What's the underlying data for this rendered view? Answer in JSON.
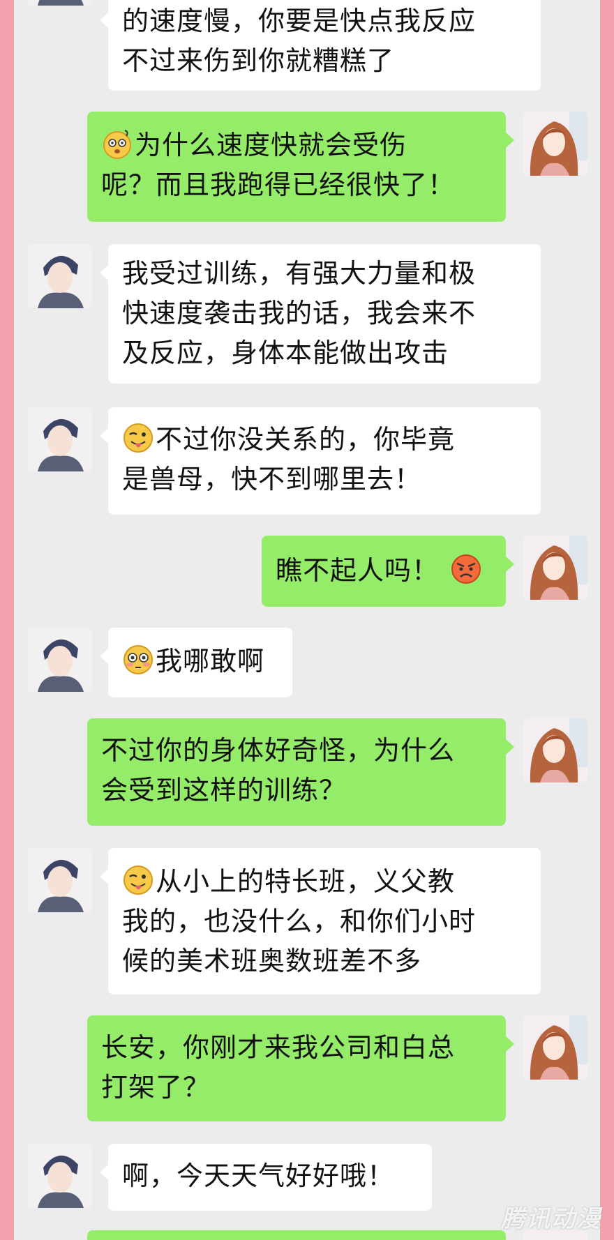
{
  "messages": [
    {
      "from": "boy",
      "lines": [
        "的速度慢，你要是快点我反应",
        "不过来伤到你就糟糕了"
      ]
    },
    {
      "from": "girl",
      "lines": [
        "为什么速度快就会受伤",
        "呢？而且我跑得已经很快了！"
      ],
      "emoji": "dizzy-face-emoji"
    },
    {
      "from": "boy",
      "lines": [
        "我受过训练，有强大力量和极",
        "快速度袭击我的话，我会来不",
        "及反应，身体本能做出攻击"
      ]
    },
    {
      "from": "boy",
      "lines": [
        "不过你没关系的，你毕竟",
        "是兽母，快不到哪里去！"
      ],
      "emoji": "tongue-wink-emoji"
    },
    {
      "from": "girl",
      "lines": [
        "瞧不起人吗！"
      ],
      "emoji": "angry-face-emoji"
    },
    {
      "from": "boy",
      "lines": [
        "我哪敢啊"
      ],
      "emoji": "flushed-face-emoji"
    },
    {
      "from": "girl",
      "lines": [
        "不过你的身体好奇怪，为什么",
        "会受到这样的训练？"
      ]
    },
    {
      "from": "boy",
      "lines": [
        "从小上的特长班，义父教",
        "我的，也没什么，和你们小时",
        "候的美术班奥数班差不多"
      ],
      "emoji": "tongue-wink-emoji"
    },
    {
      "from": "girl",
      "lines": [
        "长安，你刚才来我公司和白总",
        "打架了？"
      ]
    },
    {
      "from": "boy",
      "lines": [
        "啊，今天天气好好哦！"
      ]
    }
  ],
  "watermark": "腾讯动漫",
  "colors": {
    "page_border": "#f5a0ad",
    "chat_background": "#ececec",
    "sent_bubble": "#95ec69",
    "received_bubble": "#ffffff"
  }
}
